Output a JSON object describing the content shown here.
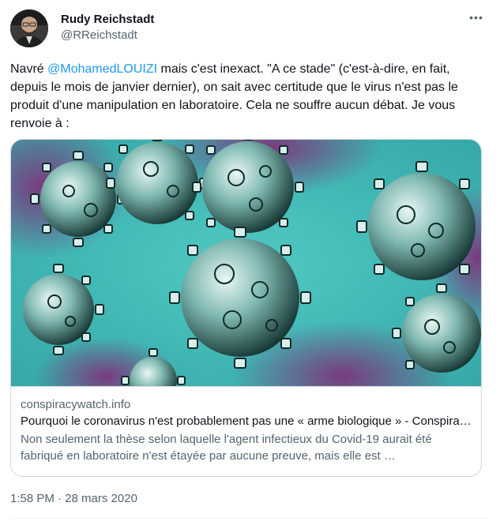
{
  "author": {
    "display_name": "Rudy Reichstadt",
    "handle": "@RReichstadt"
  },
  "more_label": "•••",
  "tweet": {
    "text_before": "Navré ",
    "mention": "@MohamedLOUIZI",
    "text_after": " mais c'est inexact. \"A ce stade\" (c'est-à-dire, en fait, depuis le mois de janvier dernier), on sait avec certitude que le virus n'est pas le produit d'une manipulation en laboratoire. Cela ne souffre aucun débat. Je vous renvoie à :"
  },
  "card": {
    "domain": "conspiracywatch.info",
    "title": "Pourquoi le coronavirus n'est probablement pas une « arme biologique » - Conspiracy Watch | L'Observatoire du conspirationnisme",
    "description": "Non seulement la thèse selon laquelle l'agent infectieux du Covid-19 aurait été fabriqué en laboratoire n'est étayée par aucune preuve, mais elle est …",
    "image_icon": "coronavirus-illustration"
  },
  "timestamp": "1:58 PM · 28 mars 2020",
  "colors": {
    "link": "#1d9bf0",
    "text": "#0f1419",
    "muted": "#536471",
    "border": "#cfd9de"
  }
}
